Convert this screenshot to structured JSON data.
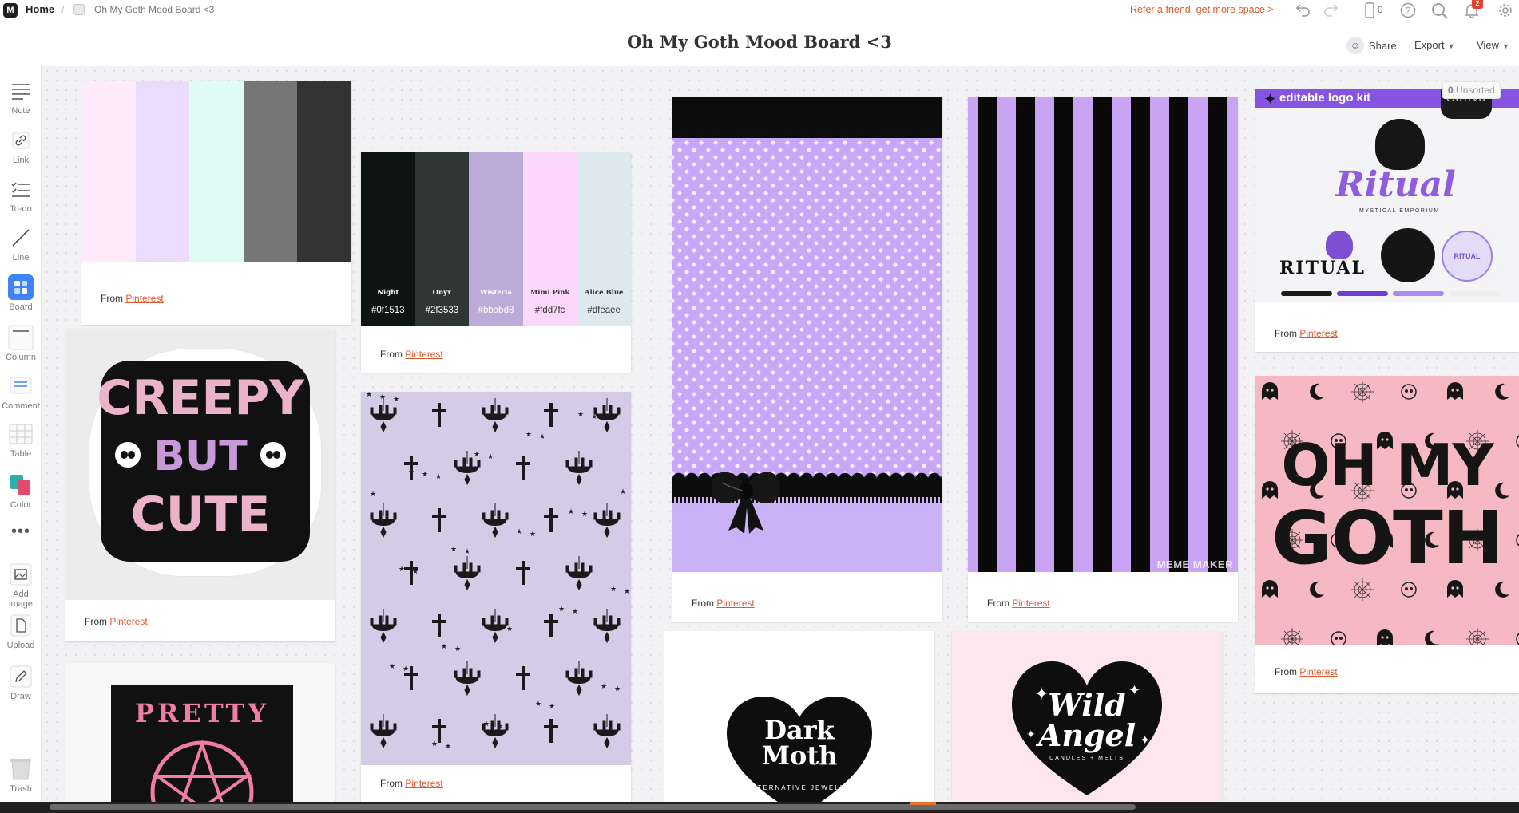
{
  "header": {
    "home_label": "Home",
    "breadcrumb_separator": "/",
    "board_crumb": "Oh My Goth Mood Board <3",
    "title": "Oh My Goth Mood Board <3",
    "refer_text": "Refer a friend, get more space >",
    "device_count": "0",
    "notification_count": "2",
    "share_label": "Share",
    "export_label": "Export",
    "view_label": "View",
    "icons": [
      "undo-icon",
      "redo-icon",
      "device-icon",
      "help-icon",
      "search-icon",
      "bell-icon",
      "gear-icon"
    ]
  },
  "toolbar": {
    "items": [
      {
        "label": "Note",
        "icon": "note-icon"
      },
      {
        "label": "Link",
        "icon": "link-icon"
      },
      {
        "label": "To-do",
        "icon": "todo-icon"
      },
      {
        "label": "Line",
        "icon": "line-icon"
      },
      {
        "label": "Board",
        "icon": "board-icon"
      },
      {
        "label": "Column",
        "icon": "column-icon"
      },
      {
        "label": "Comment",
        "icon": "comment-icon"
      },
      {
        "label": "Table",
        "icon": "table-icon"
      },
      {
        "label": "Color",
        "icon": "color-icon"
      },
      {
        "label": "",
        "icon": "more-icon"
      },
      {
        "label": "Add image",
        "icon": "image-icon"
      },
      {
        "label": "Upload",
        "icon": "upload-icon"
      },
      {
        "label": "Draw",
        "icon": "pen-icon"
      },
      {
        "label": "Trash",
        "icon": "trash-icon"
      }
    ]
  },
  "canvas": {
    "unsorted_count": "0",
    "unsorted_label": "Unsorted",
    "caption_prefix": "From",
    "caption_link": "Pinterest"
  },
  "cards": {
    "palette1": {
      "colors": [
        "#fdeafc",
        "#ebdbfc",
        "#dffbf3",
        "#767676",
        "#333333"
      ]
    },
    "palette2": {
      "swatches": [
        {
          "name": "Night",
          "hex": "#0f1513",
          "color": "#0f1513",
          "text": "#ffffff"
        },
        {
          "name": "Onyx",
          "hex": "#2f3533",
          "color": "#2f3533",
          "text": "#ffffff"
        },
        {
          "name": "Wisteria",
          "hex": "#bbabd8",
          "color": "#bbabd8",
          "text": "#ffffff"
        },
        {
          "name": "Mimi Pink",
          "hex": "#fdd7fc",
          "color": "#fdd7fc",
          "text": "#333333"
        },
        {
          "name": "Alice Blue",
          "hex": "#dfeaee",
          "color": "#dfeaee",
          "text": "#333333"
        }
      ]
    },
    "creepy": {
      "line1": "CREEPY",
      "line2": "BUT",
      "line3": "CUTE"
    },
    "pretty": {
      "word": "PRETTY"
    },
    "stripes": {
      "watermark": "MEME MAKER"
    },
    "logokit": {
      "banner": "editable logo kit",
      "brand_corner": "Canva",
      "script_word": "Ritual",
      "block_word": "RITUAL",
      "emporium": "MYSTICAL EMPORIUM",
      "badge": "RITUAL"
    },
    "ohmygoth": {
      "line1": "OH MY",
      "line2": "GOTH"
    },
    "darkmoth": {
      "line1": "Dark",
      "line2": "Moth",
      "sub": "ALTERNATIVE JEWELRY"
    },
    "wildangel": {
      "line1": "Wild",
      "line2": "Angel",
      "sub": "CANDLES + MELTS"
    }
  }
}
